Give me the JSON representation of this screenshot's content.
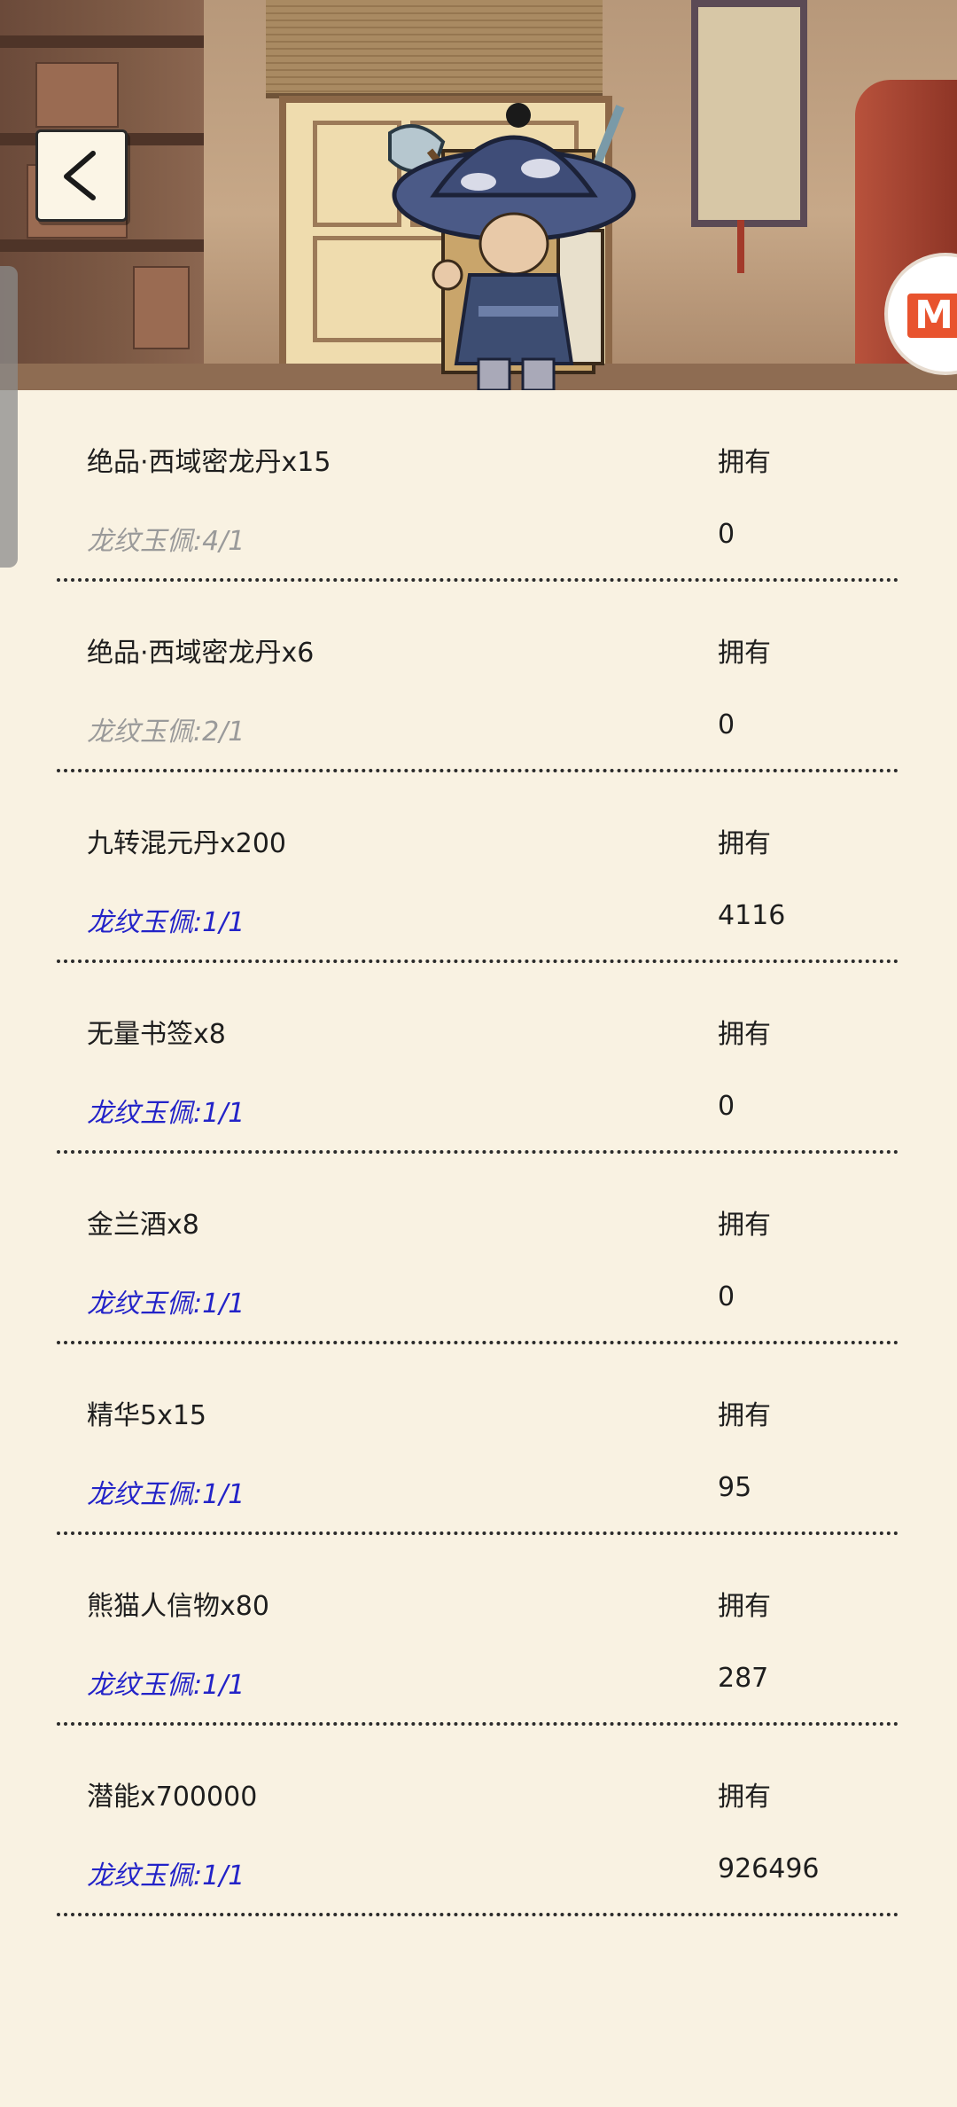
{
  "header": {
    "back_icon": "chevron-left-icon",
    "menu_badge": "M"
  },
  "items": [
    {
      "name": "绝品·西域密龙丹x15",
      "own_label": "拥有",
      "requirement": "龙纹玉佩:4/1",
      "owned": "0",
      "met": false
    },
    {
      "name": "绝品·西域密龙丹x6",
      "own_label": "拥有",
      "requirement": "龙纹玉佩:2/1",
      "owned": "0",
      "met": false
    },
    {
      "name": "九转混元丹x200",
      "own_label": "拥有",
      "requirement": "龙纹玉佩:1/1",
      "owned": "4116",
      "met": true
    },
    {
      "name": "无量书签x8",
      "own_label": "拥有",
      "requirement": "龙纹玉佩:1/1",
      "owned": "0",
      "met": true
    },
    {
      "name": "金兰酒x8",
      "own_label": "拥有",
      "requirement": "龙纹玉佩:1/1",
      "owned": "0",
      "met": true
    },
    {
      "name": "精华5x15",
      "own_label": "拥有",
      "requirement": "龙纹玉佩:1/1",
      "owned": "95",
      "met": true
    },
    {
      "name": "熊猫人信物x80",
      "own_label": "拥有",
      "requirement": "龙纹玉佩:1/1",
      "owned": "287",
      "met": true
    },
    {
      "name": "潜能x700000",
      "own_label": "拥有",
      "requirement": "龙纹玉佩:1/1",
      "owned": "926496",
      "met": true
    }
  ],
  "colors": {
    "background": "#f9f2e2",
    "requirement_met": "#2323c8",
    "requirement_unmet": "#9a9a9a",
    "text": "#1e1e1e"
  }
}
